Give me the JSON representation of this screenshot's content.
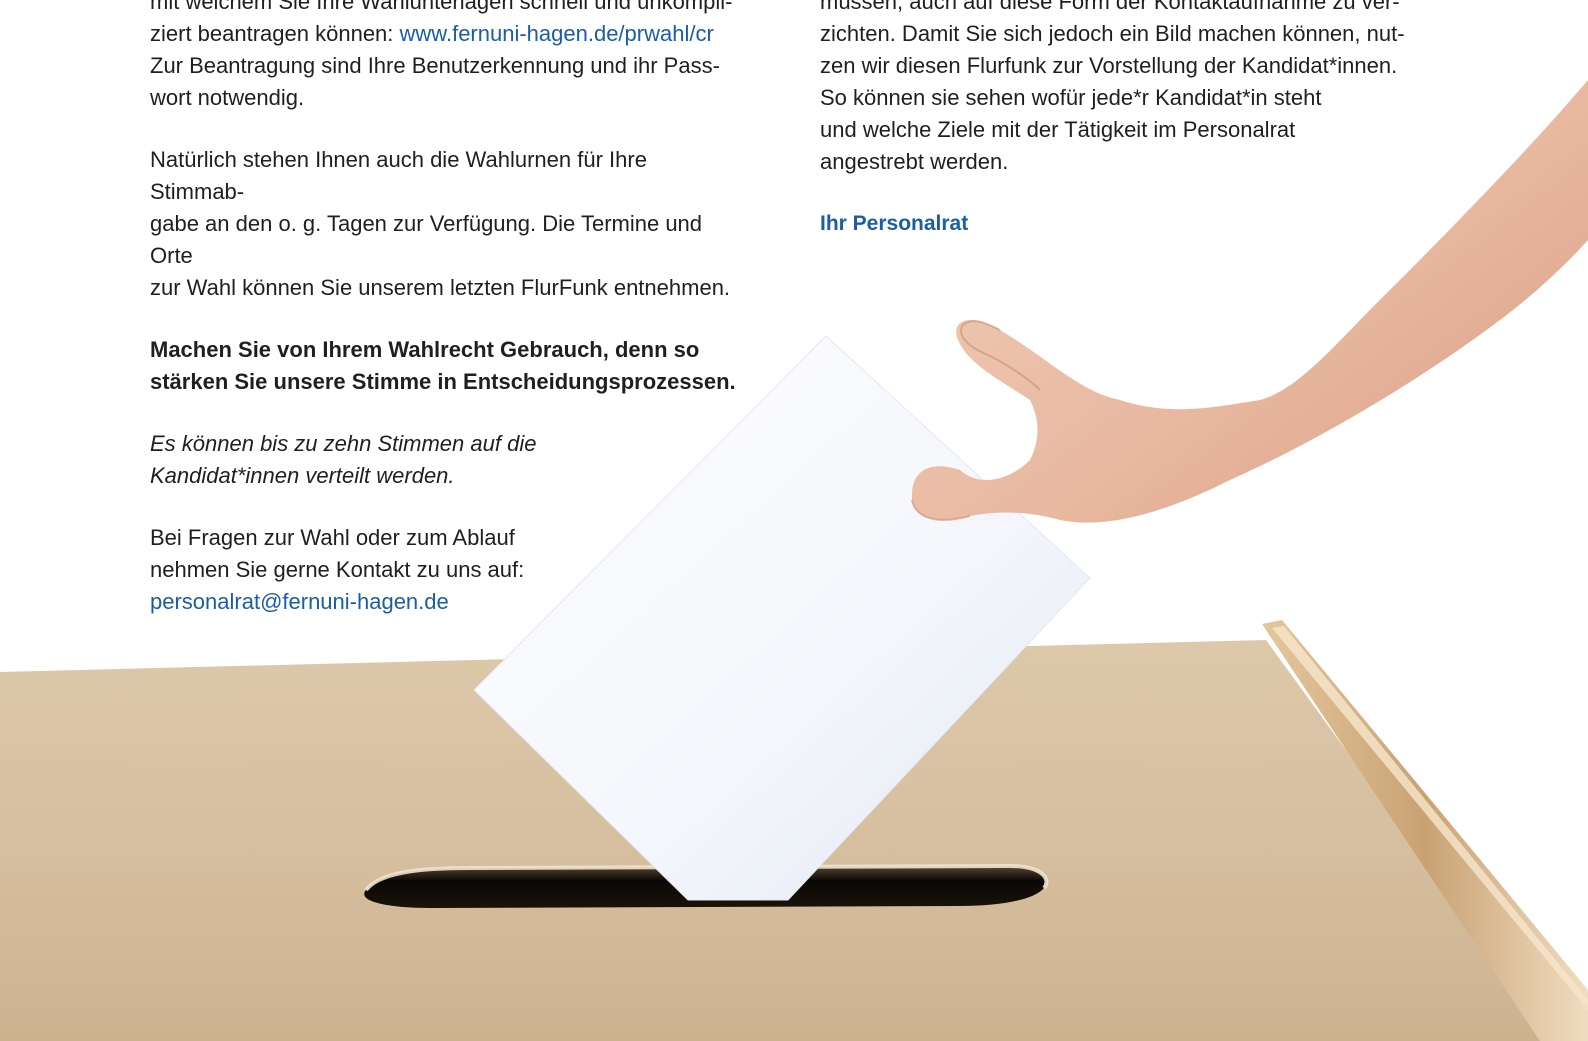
{
  "left_column": {
    "para1_line1": "mit welchem Sie Ihre Wahlunterlagen schnell und unkompli-",
    "para1_line2_prefix": "ziert beantragen können: ",
    "para1_link": "www.fernuni-hagen.de/prwahl/cr",
    "para1_line3": "Zur Beantragung sind Ihre Benutzerkennung und ihr Pass-",
    "para1_line4": "wort notwendig.",
    "para2_line1": "Natürlich stehen Ihnen auch die Wahlurnen für Ihre Stimmab-",
    "para2_line2": "gabe an den o. g. Tagen zur Verfügung. Die Termine und Orte",
    "para2_line3": "zur Wahl können Sie unserem letzten FlurFunk entnehmen.",
    "bold_line1": "Machen Sie von Ihrem Wahlrecht Gebrauch, denn so",
    "bold_line2": "stärken Sie unsere Stimme in Entscheidungsprozessen.",
    "italic_line1": "Es können bis zu zehn Stimmen auf die",
    "italic_line2": "Kandidat*innen verteilt werden.",
    "contact_line1": "Bei Fragen zur Wahl oder zum Ablauf",
    "contact_line2": "nehmen Sie gerne Kontakt zu uns auf:",
    "contact_email": "personalrat@fernuni-hagen.de"
  },
  "right_column": {
    "line1": "müssen, auch auf diese Form der Kontaktaufnahme zu ver-",
    "line2": "zichten. Damit Sie sich jedoch ein Bild machen können, nut-",
    "line3": "zen wir diesen Flurfunk zur Vorstellung der Kandidat*innen.",
    "line4": "So können sie sehen wofür jede*r Kandidat*in steht",
    "line5": "und welche Ziele mit der Tätigkeit im Personalrat",
    "line6": "angestrebt werden.",
    "signature": "Ihr Personalrat"
  },
  "colors": {
    "link": "#1a5ea8",
    "text": "#1f1f1f",
    "box": "#d7c2a4"
  }
}
